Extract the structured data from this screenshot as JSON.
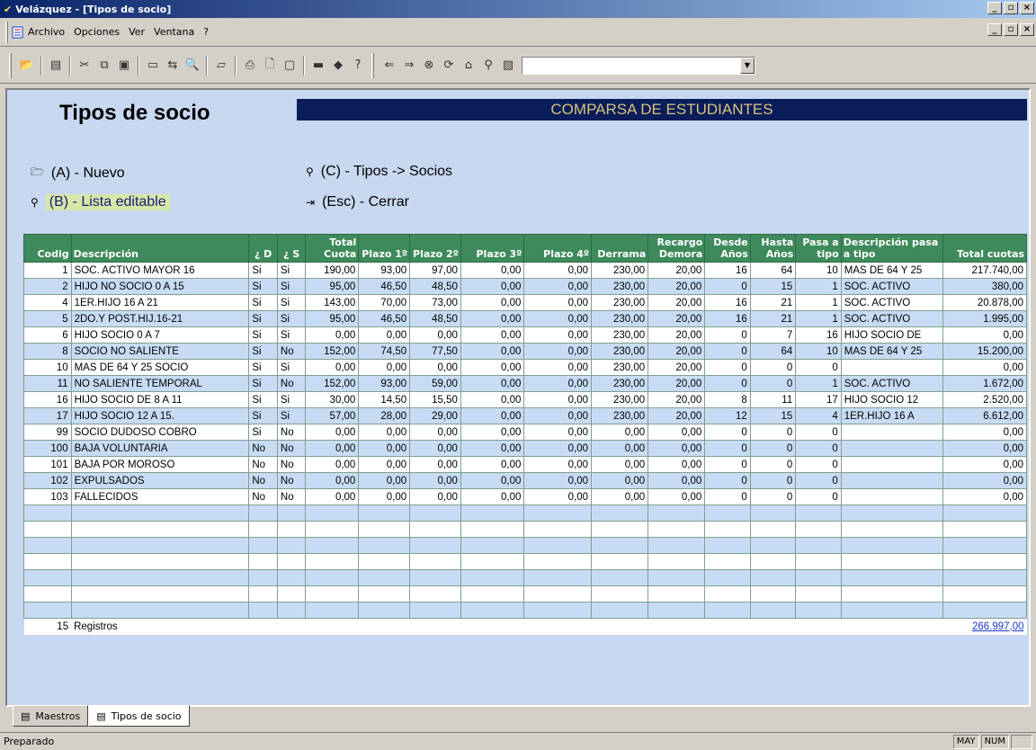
{
  "window": {
    "title": "Velázquez - [Tipos de socio]"
  },
  "menu": {
    "items": [
      "Archivo",
      "Opciones",
      "Ver",
      "Ventana",
      "?"
    ]
  },
  "form": {
    "title": "Tipos de socio",
    "banner": "COMPARSA DE ESTUDIANTES",
    "actions": {
      "nuevo": "(A) - Nuevo",
      "lista": "(B) - Lista editable",
      "tipos": "(C) - Tipos -> Socios",
      "cerrar": "(Esc) - Cerrar"
    }
  },
  "table": {
    "headers": [
      "Codig",
      "Descripción",
      "¿ D",
      "¿ S",
      "Total Cuota",
      "Plazo 1º",
      "Plazo 2º",
      "Plazo 3º",
      "Plazo 4º",
      "Derrama",
      "Recargo Demora",
      "Desde Años",
      "Hasta Años",
      "Pasa a tipo",
      "Descripción pasa a tipo",
      "Total cuotas"
    ],
    "rows": [
      [
        "1",
        "SOC. ACTIVO MAYOR 16",
        "Si",
        "Si",
        "190,00",
        "93,00",
        "97,00",
        "0,00",
        "0,00",
        "230,00",
        "20,00",
        "16",
        "64",
        "10",
        "MAS DE 64 Y 25",
        "217.740,00"
      ],
      [
        "2",
        "HIJO NO SOCIO 0 A 15",
        "Si",
        "Si",
        "95,00",
        "46,50",
        "48,50",
        "0,00",
        "0,00",
        "230,00",
        "20,00",
        "0",
        "15",
        "1",
        "SOC. ACTIVO",
        "380,00"
      ],
      [
        "4",
        "1ER.HIJO 16 A 21",
        "Si",
        "Si",
        "143,00",
        "70,00",
        "73,00",
        "0,00",
        "0,00",
        "230,00",
        "20,00",
        "16",
        "21",
        "1",
        "SOC. ACTIVO",
        "20.878,00"
      ],
      [
        "5",
        "2DO.Y POST.HIJ.16-21",
        "Si",
        "Si",
        "95,00",
        "46,50",
        "48,50",
        "0,00",
        "0,00",
        "230,00",
        "20,00",
        "16",
        "21",
        "1",
        "SOC. ACTIVO",
        "1.995,00"
      ],
      [
        "6",
        "HIJO SOCIO 0 A 7",
        "Si",
        "Si",
        "0,00",
        "0,00",
        "0,00",
        "0,00",
        "0,00",
        "230,00",
        "20,00",
        "0",
        "7",
        "16",
        "HIJO SOCIO DE",
        "0,00"
      ],
      [
        "8",
        "SOCIO NO SALIENTE",
        "Si",
        "No",
        "152,00",
        "74,50",
        "77,50",
        "0,00",
        "0,00",
        "230,00",
        "20,00",
        "0",
        "64",
        "10",
        "MAS DE 64 Y 25",
        "15.200,00"
      ],
      [
        "10",
        "MAS DE 64 Y 25 SOCIO",
        "Si",
        "Si",
        "0,00",
        "0,00",
        "0,00",
        "0,00",
        "0,00",
        "230,00",
        "20,00",
        "0",
        "0",
        "0",
        "",
        "0,00"
      ],
      [
        "11",
        "NO SALIENTE TEMPORAL",
        "Si",
        "No",
        "152,00",
        "93,00",
        "59,00",
        "0,00",
        "0,00",
        "230,00",
        "20,00",
        "0",
        "0",
        "1",
        "SOC. ACTIVO",
        "1.672,00"
      ],
      [
        "16",
        "HIJO SOCIO DE 8 A 11",
        "Si",
        "Si",
        "30,00",
        "14,50",
        "15,50",
        "0,00",
        "0,00",
        "230,00",
        "20,00",
        "8",
        "11",
        "17",
        "HIJO SOCIO 12",
        "2.520,00"
      ],
      [
        "17",
        "HIJO SOCIO 12 A 15.",
        "Si",
        "Si",
        "57,00",
        "28,00",
        "29,00",
        "0,00",
        "0,00",
        "230,00",
        "20,00",
        "12",
        "15",
        "4",
        "1ER.HIJO 16 A",
        "6.612,00"
      ],
      [
        "99",
        "SOCIO DUDOSO COBRO",
        "Si",
        "No",
        "0,00",
        "0,00",
        "0,00",
        "0,00",
        "0,00",
        "0,00",
        "0,00",
        "0",
        "0",
        "0",
        "",
        "0,00"
      ],
      [
        "100",
        "BAJA VOLUNTARIA",
        "No",
        "No",
        "0,00",
        "0,00",
        "0,00",
        "0,00",
        "0,00",
        "0,00",
        "0,00",
        "0",
        "0",
        "0",
        "",
        "0,00"
      ],
      [
        "101",
        "BAJA POR MOROSO",
        "No",
        "No",
        "0,00",
        "0,00",
        "0,00",
        "0,00",
        "0,00",
        "0,00",
        "0,00",
        "0",
        "0",
        "0",
        "",
        "0,00"
      ],
      [
        "102",
        "EXPULSADOS",
        "No",
        "No",
        "0,00",
        "0,00",
        "0,00",
        "0,00",
        "0,00",
        "0,00",
        "0,00",
        "0",
        "0",
        "0",
        "",
        "0,00"
      ],
      [
        "103",
        "FALLECIDOS",
        "No",
        "No",
        "0,00",
        "0,00",
        "0,00",
        "0,00",
        "0,00",
        "0,00",
        "0,00",
        "0",
        "0",
        "0",
        "",
        "0,00"
      ]
    ],
    "empty_rows": 7,
    "footer": {
      "count": "15",
      "label": "Registros",
      "total": "266.997,00"
    }
  },
  "tabs": [
    "Maestros",
    "Tipos de socio"
  ],
  "status": {
    "text": "Preparado",
    "indicators": [
      "MAY",
      "NUM",
      ""
    ]
  },
  "colors": {
    "header": "#3f8a5c",
    "banner": "#0a1c5a",
    "row_alt": "#c7dcf4",
    "panel": "#c7d8f0"
  }
}
